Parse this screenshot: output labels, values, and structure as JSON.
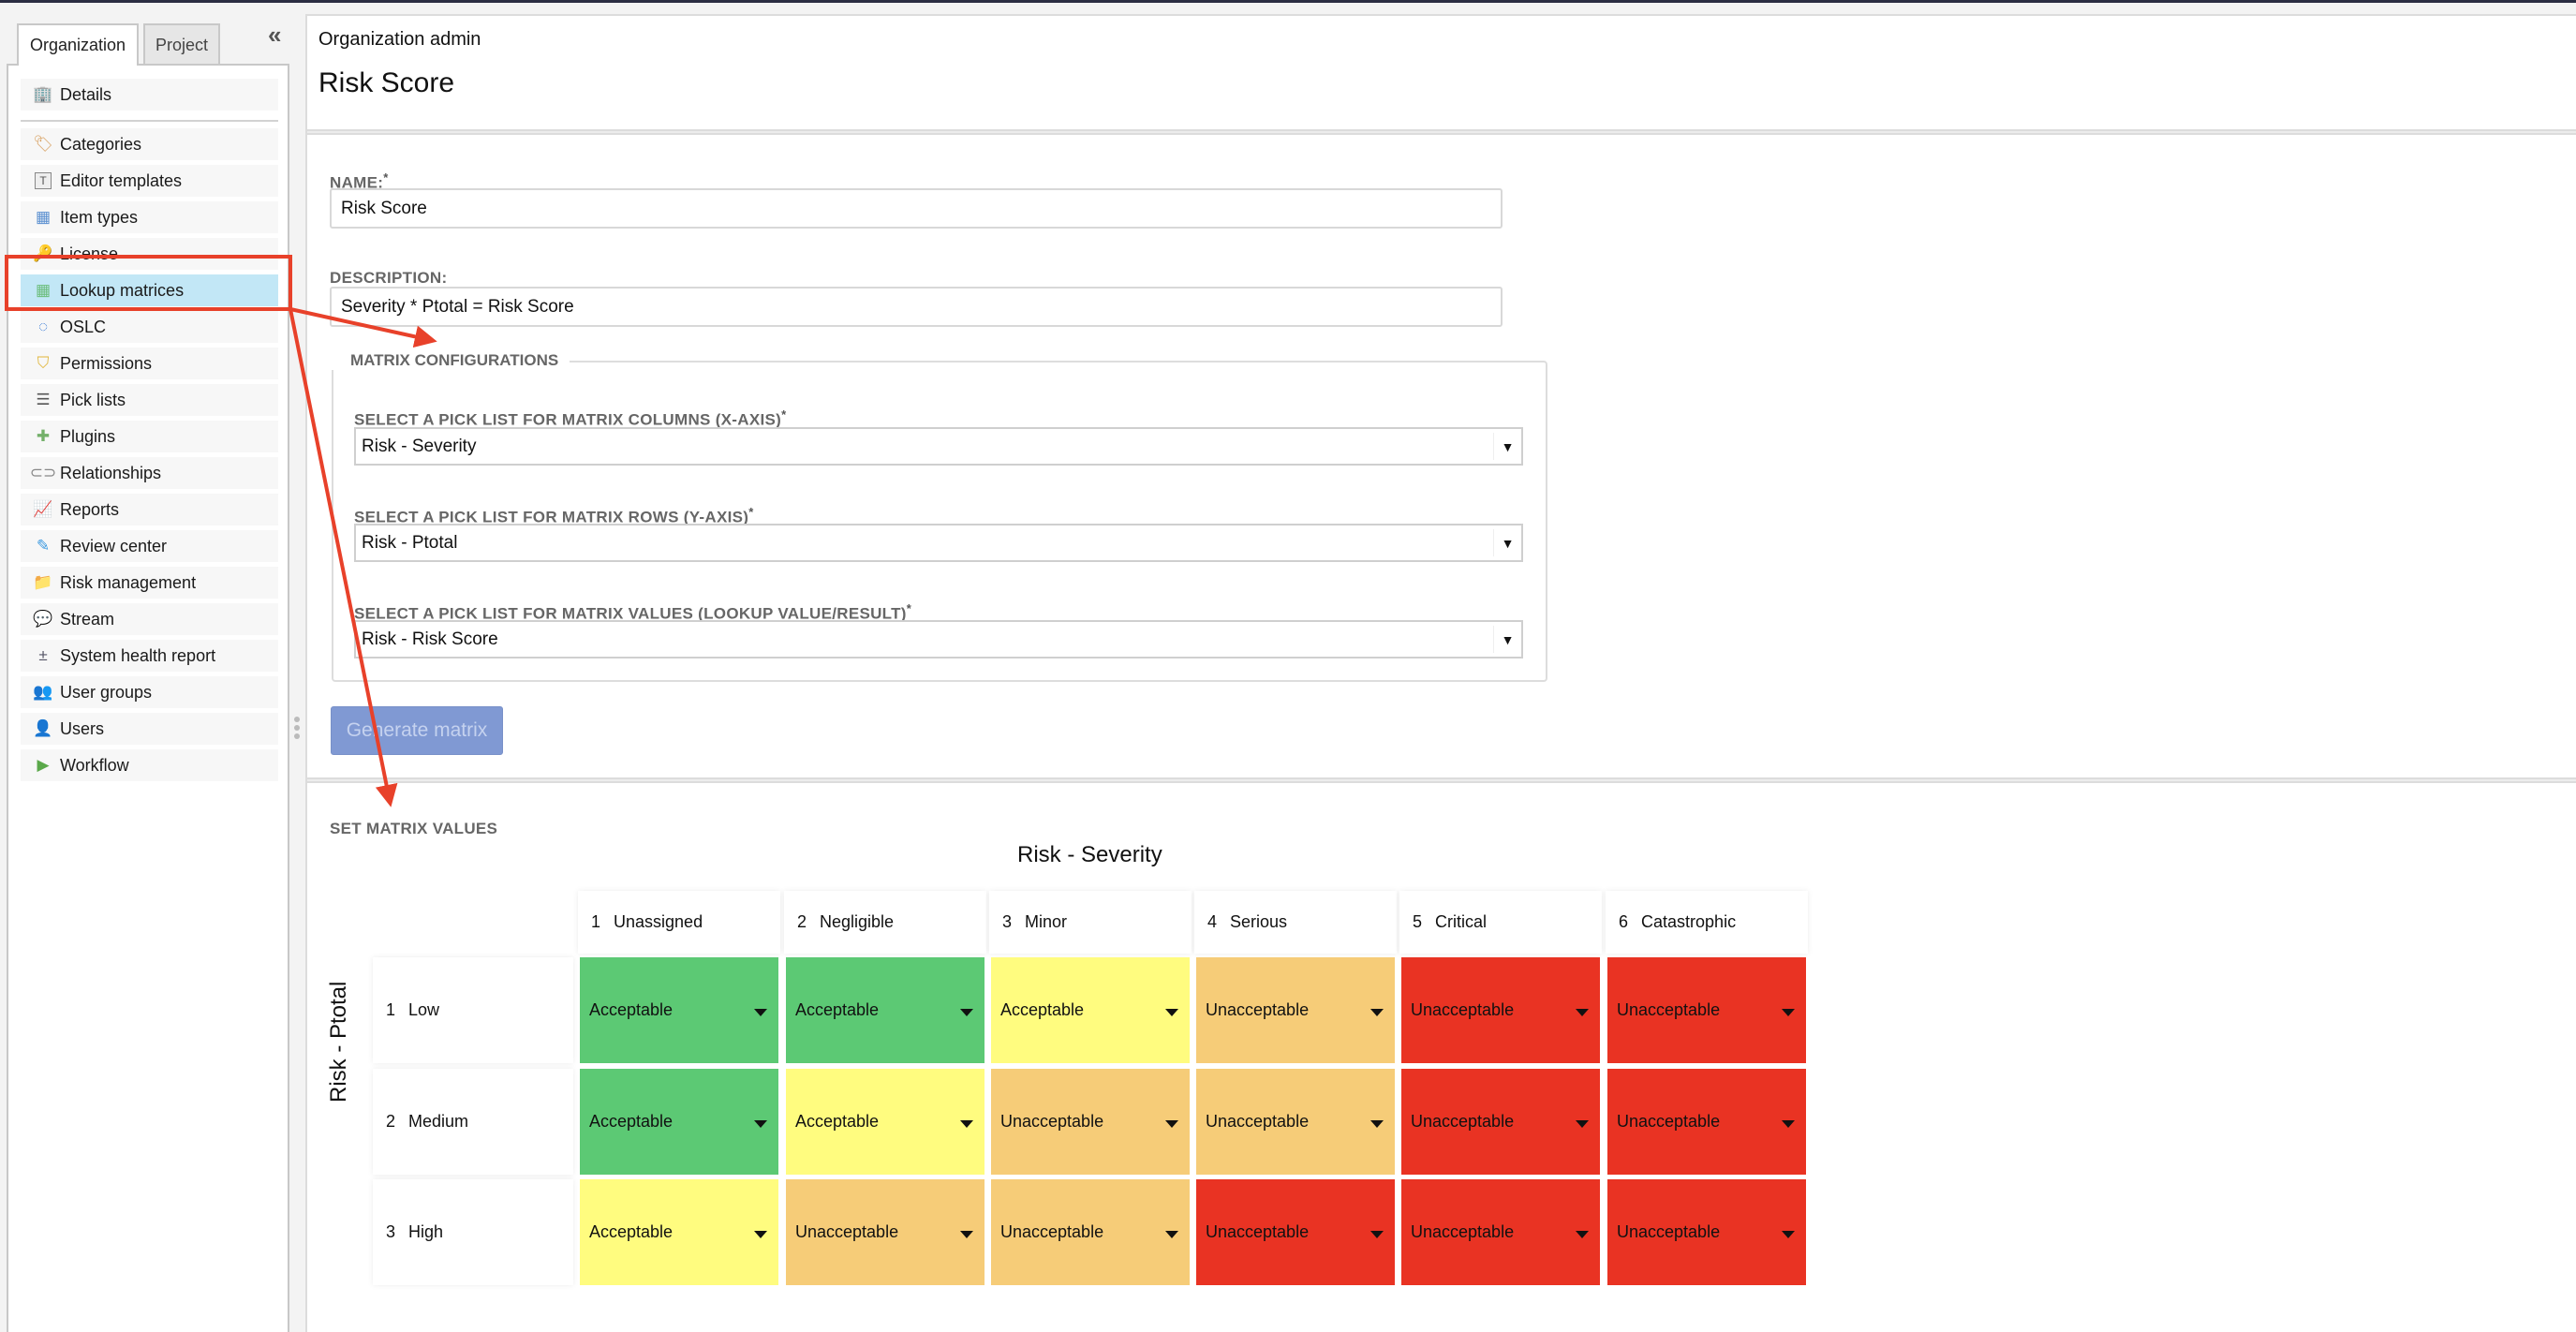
{
  "sidebar": {
    "tabs": [
      {
        "label": "Organization",
        "active": true
      },
      {
        "label": "Project",
        "active": false
      }
    ],
    "collapse_icon": "double-chevron-left-icon",
    "items": [
      {
        "label": "Details",
        "icon": "building-icon"
      },
      {
        "label": "Categories",
        "icon": "tag-icon"
      },
      {
        "label": "Editor templates",
        "icon": "template-icon"
      },
      {
        "label": "Item types",
        "icon": "item-types-icon"
      },
      {
        "label": "License",
        "icon": "key-icon"
      },
      {
        "label": "Lookup matrices",
        "icon": "matrix-icon",
        "selected": true
      },
      {
        "label": "OSLC",
        "icon": "oslc-icon"
      },
      {
        "label": "Permissions",
        "icon": "shield-icon"
      },
      {
        "label": "Pick lists",
        "icon": "list-icon"
      },
      {
        "label": "Plugins",
        "icon": "puzzle-icon"
      },
      {
        "label": "Relationships",
        "icon": "link-icon"
      },
      {
        "label": "Reports",
        "icon": "chart-icon"
      },
      {
        "label": "Review center",
        "icon": "review-icon"
      },
      {
        "label": "Risk management",
        "icon": "folder-icon"
      },
      {
        "label": "Stream",
        "icon": "speech-bubble-icon"
      },
      {
        "label": "System health report",
        "icon": "health-report-icon"
      },
      {
        "label": "User groups",
        "icon": "user-group-icon"
      },
      {
        "label": "Users",
        "icon": "user-icon"
      },
      {
        "label": "Workflow",
        "icon": "workflow-icon"
      }
    ]
  },
  "header": {
    "breadcrumb": "Organization admin",
    "title": "Risk Score"
  },
  "form": {
    "name_label": "NAME:",
    "name_required": "*",
    "name_value": "Risk Score",
    "description_label": "DESCRIPTION:",
    "description_value": "Severity * Ptotal = Risk Score",
    "matrix_config_legend": "MATRIX CONFIGURATIONS",
    "columns_label": "SELECT A PICK LIST FOR MATRIX COLUMNS (X-AXIS)",
    "columns_value": "Risk - Severity",
    "rows_label": "SELECT A PICK LIST FOR MATRIX ROWS (Y-AXIS)",
    "rows_value": "Risk - Ptotal",
    "values_label": "SELECT A PICK LIST FOR MATRIX VALUES (LOOKUP VALUE/RESULT)",
    "values_value": "Risk - Risk Score",
    "required_mark": "*",
    "generate_button": "Generate matrix"
  },
  "matrix": {
    "section_label": "SET MATRIX VALUES",
    "x_axis_title": "Risk - Severity",
    "y_axis_title": "Risk - Ptotal",
    "columns": [
      {
        "num": "1",
        "label": "Unassigned"
      },
      {
        "num": "2",
        "label": "Negligible"
      },
      {
        "num": "3",
        "label": "Minor"
      },
      {
        "num": "4",
        "label": "Serious"
      },
      {
        "num": "5",
        "label": "Critical"
      },
      {
        "num": "6",
        "label": "Catastrophic"
      }
    ],
    "rows": [
      {
        "num": "1",
        "label": "Low",
        "cells": [
          {
            "value": "Acceptable",
            "color": "#5cc974"
          },
          {
            "value": "Acceptable",
            "color": "#5cc974"
          },
          {
            "value": "Acceptable",
            "color": "#fffc7f"
          },
          {
            "value": "Unacceptable",
            "color": "#f6cc78"
          },
          {
            "value": "Unacceptable",
            "color": "#e93323"
          },
          {
            "value": "Unacceptable",
            "color": "#e93323"
          }
        ]
      },
      {
        "num": "2",
        "label": "Medium",
        "cells": [
          {
            "value": "Acceptable",
            "color": "#5cc974"
          },
          {
            "value": "Acceptable",
            "color": "#fffc7f"
          },
          {
            "value": "Unacceptable",
            "color": "#f6cc78"
          },
          {
            "value": "Unacceptable",
            "color": "#f6cc78"
          },
          {
            "value": "Unacceptable",
            "color": "#e93323"
          },
          {
            "value": "Unacceptable",
            "color": "#e93323"
          }
        ]
      },
      {
        "num": "3",
        "label": "High",
        "cells": [
          {
            "value": "Acceptable",
            "color": "#fffc7f"
          },
          {
            "value": "Unacceptable",
            "color": "#f6cc78"
          },
          {
            "value": "Unacceptable",
            "color": "#f6cc78"
          },
          {
            "value": "Unacceptable",
            "color": "#e93323"
          },
          {
            "value": "Unacceptable",
            "color": "#e93323"
          },
          {
            "value": "Unacceptable",
            "color": "#e93323"
          }
        ]
      }
    ]
  },
  "colors": {
    "selected_item_bg": "#c2e7f6",
    "annotation_red": "#e8412a",
    "button_bg": "#8099d3"
  }
}
